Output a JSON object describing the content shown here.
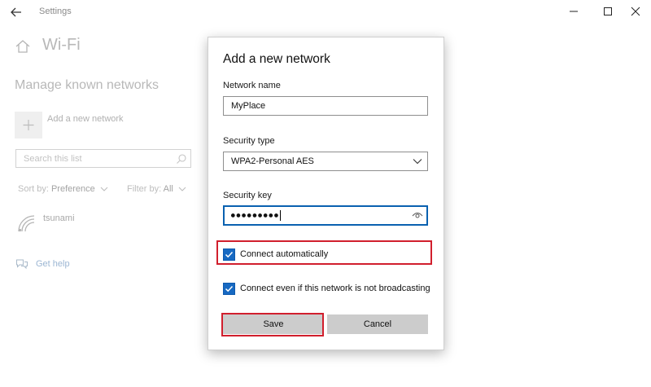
{
  "window": {
    "app_title": "Settings",
    "buttons": [
      "minimize",
      "maximize",
      "close"
    ]
  },
  "background": {
    "page_title": "Wi-Fi",
    "section_title": "Manage known networks",
    "add_network_label": "Add a new network",
    "search_placeholder": "Search this list",
    "sort_label": "Sort by:",
    "sort_value": "Preference",
    "filter_label": "Filter by:",
    "filter_value": "All",
    "networks": [
      {
        "name": "tsunami"
      }
    ],
    "help_link": "Get help"
  },
  "dialog": {
    "title": "Add a new network",
    "network_name_label": "Network name",
    "network_name_value": "MyPlace",
    "security_type_label": "Security type",
    "security_type_value": "WPA2-Personal AES",
    "security_key_label": "Security key",
    "security_key_value": "●●●●●●●●●",
    "connect_automatically": {
      "label": "Connect automatically",
      "checked": true
    },
    "connect_hidden": {
      "label": "Connect even if this network is not broadcasting",
      "checked": true
    },
    "save_label": "Save",
    "cancel_label": "Cancel"
  },
  "colors": {
    "accent": "#1769c2",
    "highlight": "#d11f2d",
    "button_bg": "#cccccc"
  },
  "icons": [
    "back-arrow-icon",
    "minimize-icon",
    "maximize-icon",
    "close-icon",
    "home-icon",
    "plus-icon",
    "search-icon",
    "chevron-down-icon",
    "wifi-icon",
    "help-icon",
    "eye-icon",
    "checkmark-icon"
  ]
}
